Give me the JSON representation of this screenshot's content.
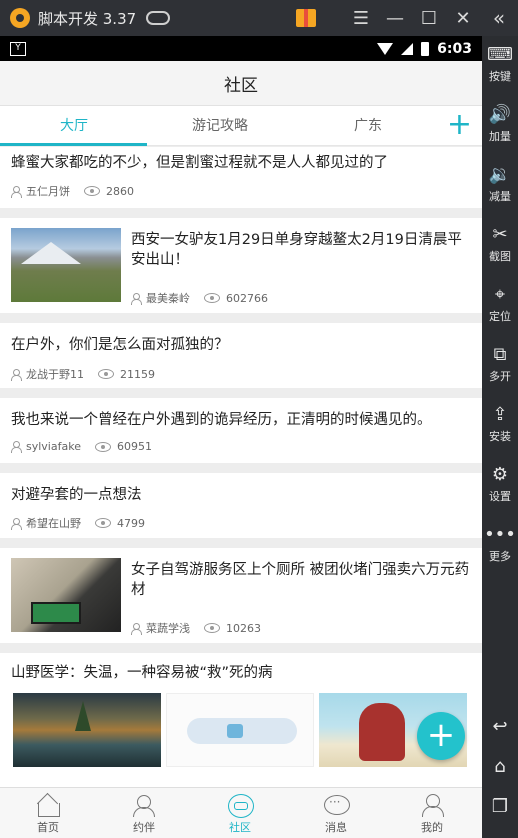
{
  "emulator": {
    "title": "脚本开发 3.37",
    "logo_icon": "app-logo-icon",
    "gamepad_icon": "gamepad-icon",
    "gift_icon": "gift-icon",
    "menu_glyph": "☰",
    "minimize_glyph": "—",
    "maximize_glyph": "☐",
    "close_glyph": "✕",
    "collapse_glyph": "«",
    "sidebar": [
      {
        "label": "按键",
        "icon": "keyboard-icon",
        "glyph": "⌨"
      },
      {
        "label": "加量",
        "icon": "volume-up-icon",
        "glyph": "🔊"
      },
      {
        "label": "减量",
        "icon": "volume-down-icon",
        "glyph": "🔉"
      },
      {
        "label": "截图",
        "icon": "scissors-icon",
        "glyph": "✂"
      },
      {
        "label": "定位",
        "icon": "location-icon",
        "glyph": "⌖"
      },
      {
        "label": "多开",
        "icon": "multi-instance-icon",
        "glyph": "⧉"
      },
      {
        "label": "安装",
        "icon": "apk-install-icon",
        "glyph": "⇪"
      },
      {
        "label": "设置",
        "icon": "gear-icon",
        "glyph": "⚙"
      },
      {
        "label": "更多",
        "icon": "more-icon",
        "glyph": "•••"
      }
    ],
    "nav_back_glyph": "↩",
    "nav_home_glyph": "⌂",
    "nav_recent_glyph": "❐"
  },
  "statusbar": {
    "app_glyph": "Y",
    "time": "6:03"
  },
  "appbar": {
    "title": "社区"
  },
  "tabs": [
    {
      "label": "大厅",
      "active": true
    },
    {
      "label": "游记攻略",
      "active": false
    },
    {
      "label": "广东",
      "active": false
    }
  ],
  "tab_add_glyph": "+",
  "posts": [
    {
      "title": "蜂蜜大家都吃的不少，但是割蜜过程就不是人人都见过的了",
      "author": "五仁月饼",
      "views": "2860"
    },
    {
      "title": "西安一女驴友1月29日单身穿越鳌太2月19日清晨平安出山！",
      "author": "最美秦岭",
      "views": "602766"
    },
    {
      "title": "在户外，你们是怎么面对孤独的？",
      "author": "龙战于野11",
      "views": "21159"
    },
    {
      "title": "我也来说一个曾经在户外遇到的诡异经历，正清明的时候遇见的。",
      "author": "sylviafake",
      "views": "60951"
    },
    {
      "title": "对避孕套的一点想法",
      "author": "希望在山野",
      "views": "4799"
    },
    {
      "title": "女子自驾游服务区上个厕所 被团伙堵门强卖六万元药材",
      "author": "菜蔬学浅",
      "views": "10263"
    },
    {
      "title": "山野医学：失温，一种容易被“救”死的病"
    }
  ],
  "fab_glyph": "+",
  "bottom_nav": [
    {
      "label": "首页",
      "icon": "home-icon",
      "active": false
    },
    {
      "label": "约伴",
      "icon": "companions-icon",
      "active": false
    },
    {
      "label": "社区",
      "icon": "community-icon",
      "active": true
    },
    {
      "label": "消息",
      "icon": "message-icon",
      "active": false
    },
    {
      "label": "我的",
      "icon": "profile-icon",
      "active": false
    }
  ],
  "accent_color": "#1fb5c7"
}
